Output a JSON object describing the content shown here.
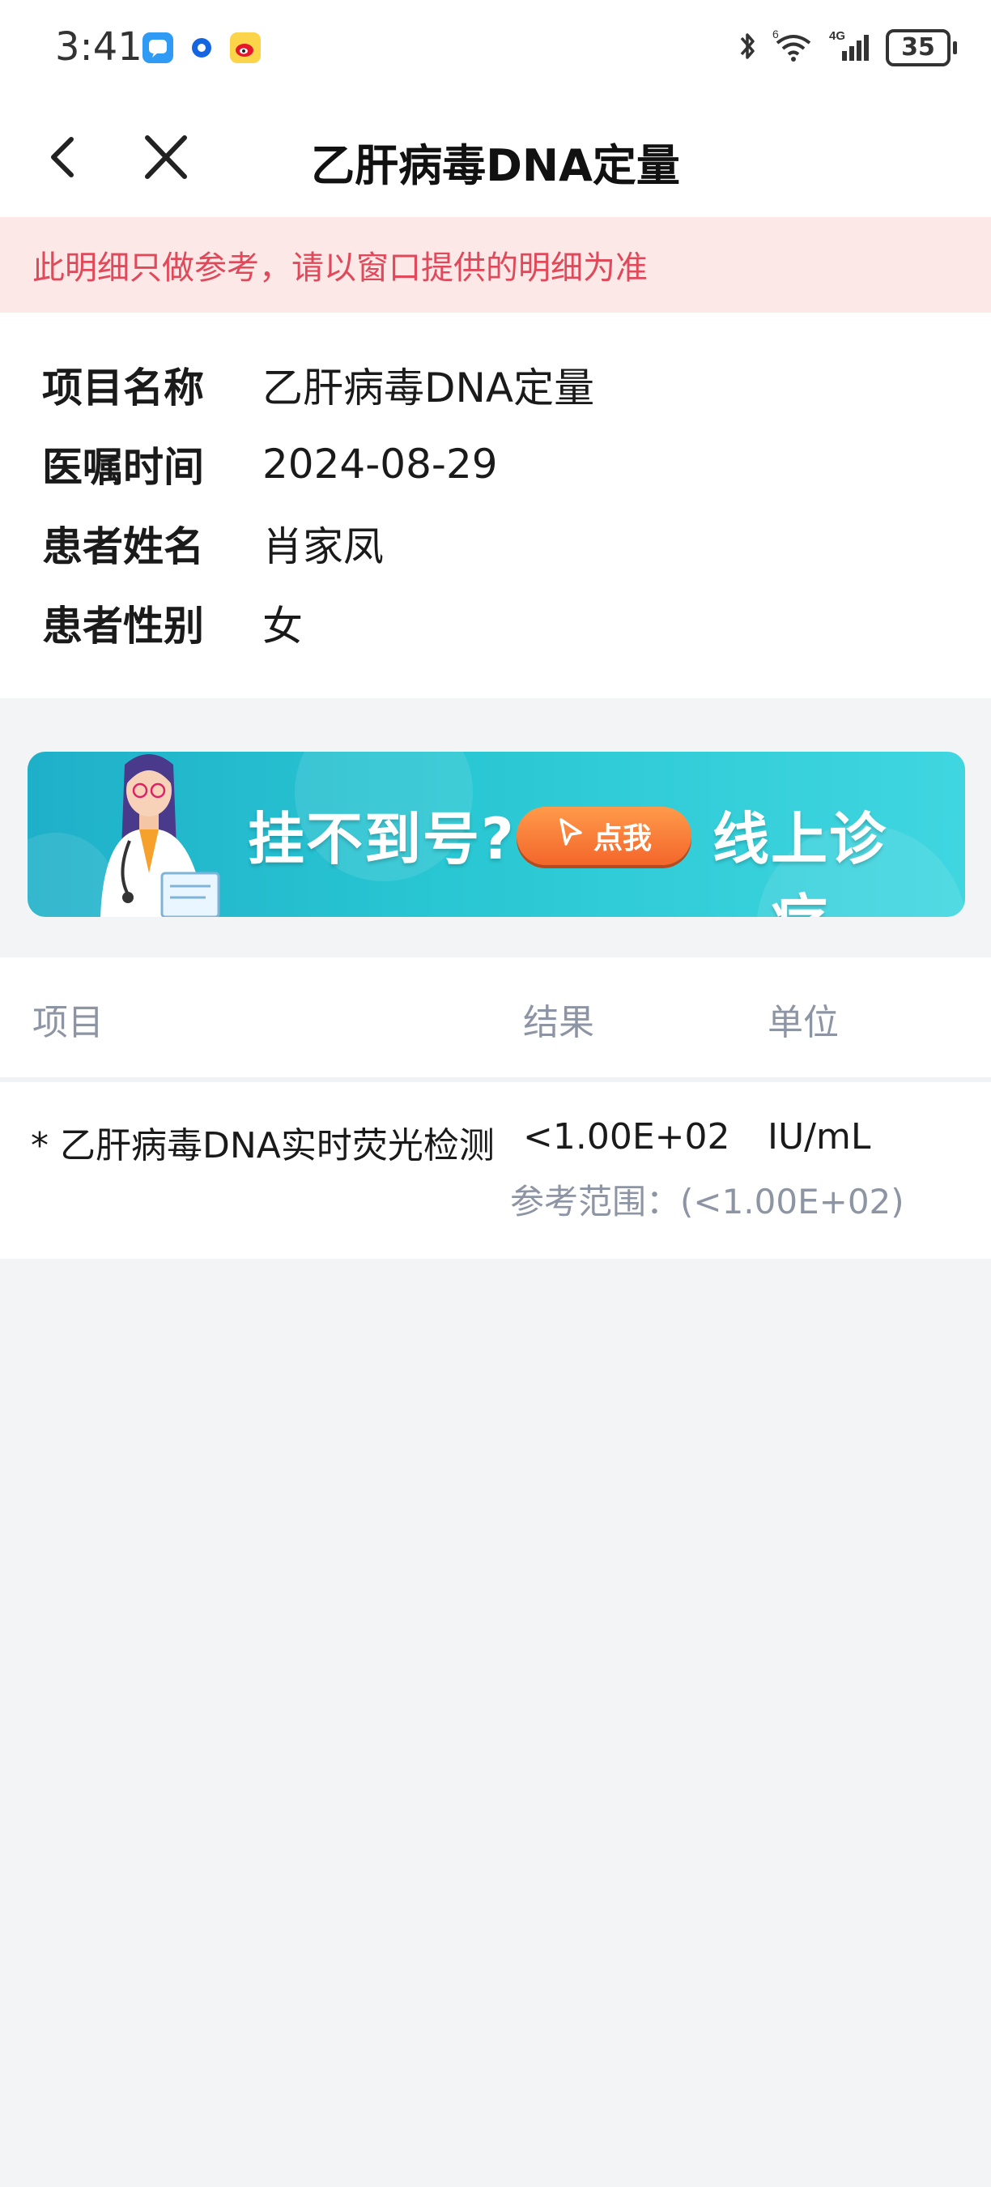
{
  "status_bar": {
    "time": "3:41",
    "battery": "35",
    "network": "4G",
    "wifi_sub": "6",
    "apps": [
      "message-app-icon",
      "browser-app-icon",
      "weibo-app-icon"
    ]
  },
  "nav": {
    "title": "乙肝病毒DNA定量",
    "back_icon": "chevron-left-icon",
    "close_icon": "close-icon"
  },
  "notice": {
    "text": "此明细只做参考，请以窗口提供的明细为准",
    "color": "#e0495a",
    "background": "#fde8e8"
  },
  "info": [
    {
      "label": "项目名称",
      "value": "乙肝病毒DNA定量"
    },
    {
      "label": "医嘱时间",
      "value": "2024-08-29"
    },
    {
      "label": "患者姓名",
      "value": "肖家凤"
    },
    {
      "label": "患者性别",
      "value": "女"
    }
  ],
  "banner": {
    "headline": "挂不到号?",
    "button_label": "点我",
    "tagline": "线上诊疗"
  },
  "results": {
    "columns": [
      "项目",
      "结果",
      "单位"
    ],
    "rows": [
      {
        "item": "* 乙肝病毒DNA实时荧光检测",
        "value": "<1.00E+02",
        "unit": "IU/mL",
        "reference": "参考范围：(<1.00E+02)"
      }
    ]
  }
}
